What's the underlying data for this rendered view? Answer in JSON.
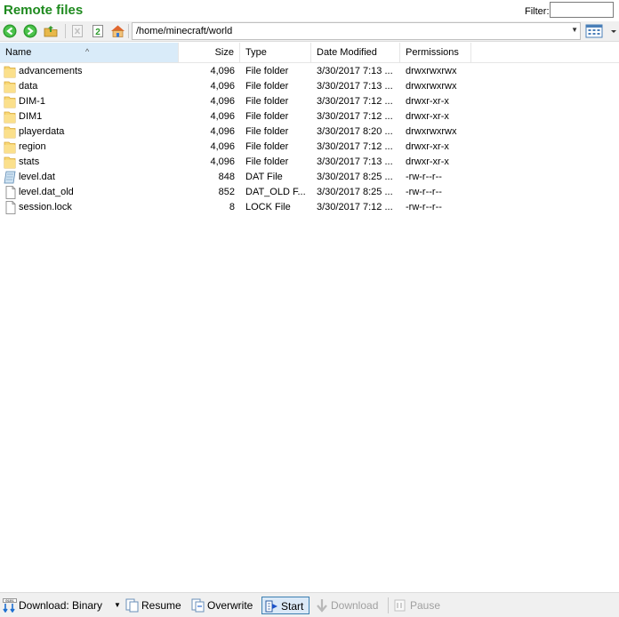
{
  "panel": {
    "title": "Remote files",
    "filter_label": "Filter:",
    "filter_value": ""
  },
  "address": {
    "path": "/home/minecraft/world"
  },
  "icons": {
    "back": "back-arrow-icon",
    "forward": "forward-arrow-icon",
    "up_folder": "folder-up-icon",
    "delete": "delete-icon",
    "refresh": "refresh-icon",
    "home": "home-icon",
    "view": "view-mode-icon"
  },
  "columns": {
    "name": "Name",
    "size": "Size",
    "type": "Type",
    "date": "Date Modified",
    "perm": "Permissions"
  },
  "files": [
    {
      "icon": "folder",
      "name": "advancements",
      "size": "4,096",
      "type": "File folder",
      "date": "3/30/2017 7:13 ...",
      "perm": "drwxrwxrwx"
    },
    {
      "icon": "folder",
      "name": "data",
      "size": "4,096",
      "type": "File folder",
      "date": "3/30/2017 7:13 ...",
      "perm": "drwxrwxrwx"
    },
    {
      "icon": "folder",
      "name": "DIM-1",
      "size": "4,096",
      "type": "File folder",
      "date": "3/30/2017 7:12 ...",
      "perm": "drwxr-xr-x"
    },
    {
      "icon": "folder",
      "name": "DIM1",
      "size": "4,096",
      "type": "File folder",
      "date": "3/30/2017 7:12 ...",
      "perm": "drwxr-xr-x"
    },
    {
      "icon": "folder",
      "name": "playerdata",
      "size": "4,096",
      "type": "File folder",
      "date": "3/30/2017 8:20 ...",
      "perm": "drwxrwxrwx"
    },
    {
      "icon": "folder",
      "name": "region",
      "size": "4,096",
      "type": "File folder",
      "date": "3/30/2017 7:12 ...",
      "perm": "drwxr-xr-x"
    },
    {
      "icon": "folder",
      "name": "stats",
      "size": "4,096",
      "type": "File folder",
      "date": "3/30/2017 7:13 ...",
      "perm": "drwxr-xr-x"
    },
    {
      "icon": "dat",
      "name": "level.dat",
      "size": "848",
      "type": "DAT File",
      "date": "3/30/2017 8:25 ...",
      "perm": "-rw-r--r--"
    },
    {
      "icon": "file",
      "name": "level.dat_old",
      "size": "852",
      "type": "DAT_OLD F...",
      "date": "3/30/2017 8:25 ...",
      "perm": "-rw-r--r--"
    },
    {
      "icon": "file",
      "name": "session.lock",
      "size": "8",
      "type": "LOCK File",
      "date": "3/30/2017 7:12 ...",
      "perm": "-rw-r--r--"
    }
  ],
  "bottom": {
    "download_mode": "Download: Binary",
    "resume": "Resume",
    "overwrite": "Overwrite",
    "start": "Start",
    "download": "Download",
    "pause": "Pause"
  }
}
